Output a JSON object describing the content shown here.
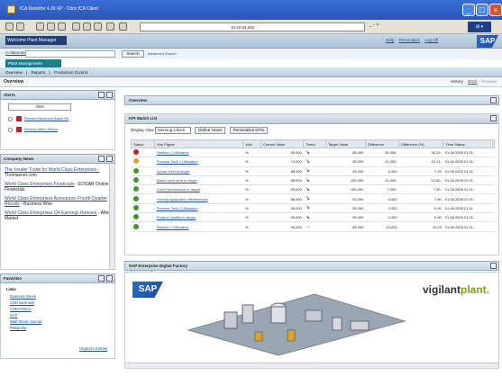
{
  "window": {
    "title": "ICA Detektor 4.30 XP - Citrix ICA Client",
    "address": "10.22.83.252"
  },
  "header": {
    "welcome": "Welcome Plant Manager",
    "links": [
      "Help",
      "Personalize",
      "Log Off"
    ],
    "logo": "SAP"
  },
  "collab": {
    "label": "Collaboration",
    "search_button": "Search",
    "advanced": "Advanced Search"
  },
  "nav": {
    "tab": "Plant Management",
    "subnav": [
      "Overview",
      "|",
      "Reports",
      "|",
      "Production Control"
    ]
  },
  "page": {
    "title": "Overview",
    "history": "History",
    "back": "Back",
    "forward": "Forward"
  },
  "alerts": {
    "title": "Alerts",
    "filter": "Alert",
    "items": [
      "Review Electronic Batch Re",
      "Review Batch Status"
    ]
  },
  "news": {
    "title": "Company News",
    "items": [
      {
        "link": "The 'Insider Trade for World Class Enterprises -",
        "source": "Thomasnet.com"
      },
      {
        "link": "World Class Enterprises Financials",
        "source": "- EDGAR Online Financials"
      },
      {
        "link": "World Class Enterprises Announces Fourth Quarter Results",
        "source": "- Business Wire"
      },
      {
        "link": "World Class Enterprises Q4 Earnings Release",
        "source": "- After Market"
      }
    ]
  },
  "favorites": {
    "title": "Favorites",
    "links_title": "Links",
    "links": [
      "Business Week",
      "CNN Business",
      "CNN Politics",
      "SAP",
      "Wall Street Journal",
      "Wikipedia"
    ],
    "organize": "Organize Entries"
  },
  "main": {
    "overview_title": "Overview",
    "kpi_title": "KPI Watch List",
    "display_label": "Display View",
    "display_value": "Morning Check",
    "define_views": "Define Views",
    "personalize_kpis": "Personalize KPIs",
    "refresh": "Refresh",
    "df_title": "SAP Enterprise Digital Factory",
    "df_logo": "SAP",
    "vp_a": "vigilant",
    "vp_b": "plant."
  },
  "kpi": {
    "headers": [
      "Status",
      "Key Figure",
      "Unit",
      "Current Value",
      "Trend",
      "Target Value",
      "Difference",
      "Difference (%)",
      "Time Stamp"
    ],
    "rows": [
      {
        "status": "#c0202a",
        "kf": "Reactor 1 Utilization",
        "unit": "%",
        "cur": "55,000",
        "trend": "↘",
        "target": "85,000",
        "diff": "30,000-",
        "pct": "35,29-",
        "ts": "01.06.2005 21:31"
      },
      {
        "status": "#e0a020",
        "kf": "Process Tank 1 Utilization",
        "unit": "%",
        "cur": "74,000",
        "trend": "↘",
        "target": "95,000",
        "diff": "21,000-",
        "pct": "22,11-",
        "ts": "01.06.2005 21:31"
      },
      {
        "status": "#3a9a2a",
        "kf": "Actual Yield to target",
        "unit": "%",
        "cur": "88,000",
        "trend": "↘",
        "target": "95,000",
        "diff": "6,000",
        "pct": "7,25",
        "ts": "01.06.2005 21:31"
      },
      {
        "status": "#3a9a2a",
        "kf": "Batch cycle time to target",
        "unit": "%",
        "cur": "88,000",
        "trend": "↘",
        "target": "100,000",
        "diff": "12,000-",
        "pct": "12,00-",
        "ts": "01.06.2005 21:31"
      },
      {
        "status": "#3a9a2a",
        "kf": "Cost Performance to target",
        "unit": "%",
        "cur": "93,000",
        "trend": "↘",
        "target": "100,000",
        "diff": "7,000-",
        "pct": "7,00-",
        "ts": "01.06.2005 21:31"
      },
      {
        "status": "#3a9a2a",
        "kf": "Overall equipment effectiveness",
        "unit": "%",
        "cur": "86,000",
        "trend": "↘",
        "target": "93,000",
        "diff": "6,000",
        "pct": "7,50",
        "ts": "01.06.2005 21:31"
      },
      {
        "status": "#3a9a2a",
        "kf": "Process Tank 2 Utilization",
        "unit": "%",
        "cur": "95,000",
        "trend": "↘",
        "target": "95,000",
        "diff": "0,000",
        "pct": "0,00",
        "ts": "01.06.2005 21:31"
      },
      {
        "status": "#3a9a2a",
        "kf": "Product Quality to target",
        "unit": "%",
        "cur": "95,000",
        "trend": "↘",
        "target": "95,000",
        "diff": "0,000",
        "pct": "0,00",
        "ts": "01.06.2005 21:31"
      },
      {
        "status": "#3a9a2a",
        "kf": "Reactor 2 Utilization",
        "unit": "%",
        "cur": "90,000",
        "trend": "→",
        "target": "85,000",
        "diff": "13,000",
        "pct": "15,29",
        "ts": "01.06.2005 21:31"
      }
    ]
  }
}
